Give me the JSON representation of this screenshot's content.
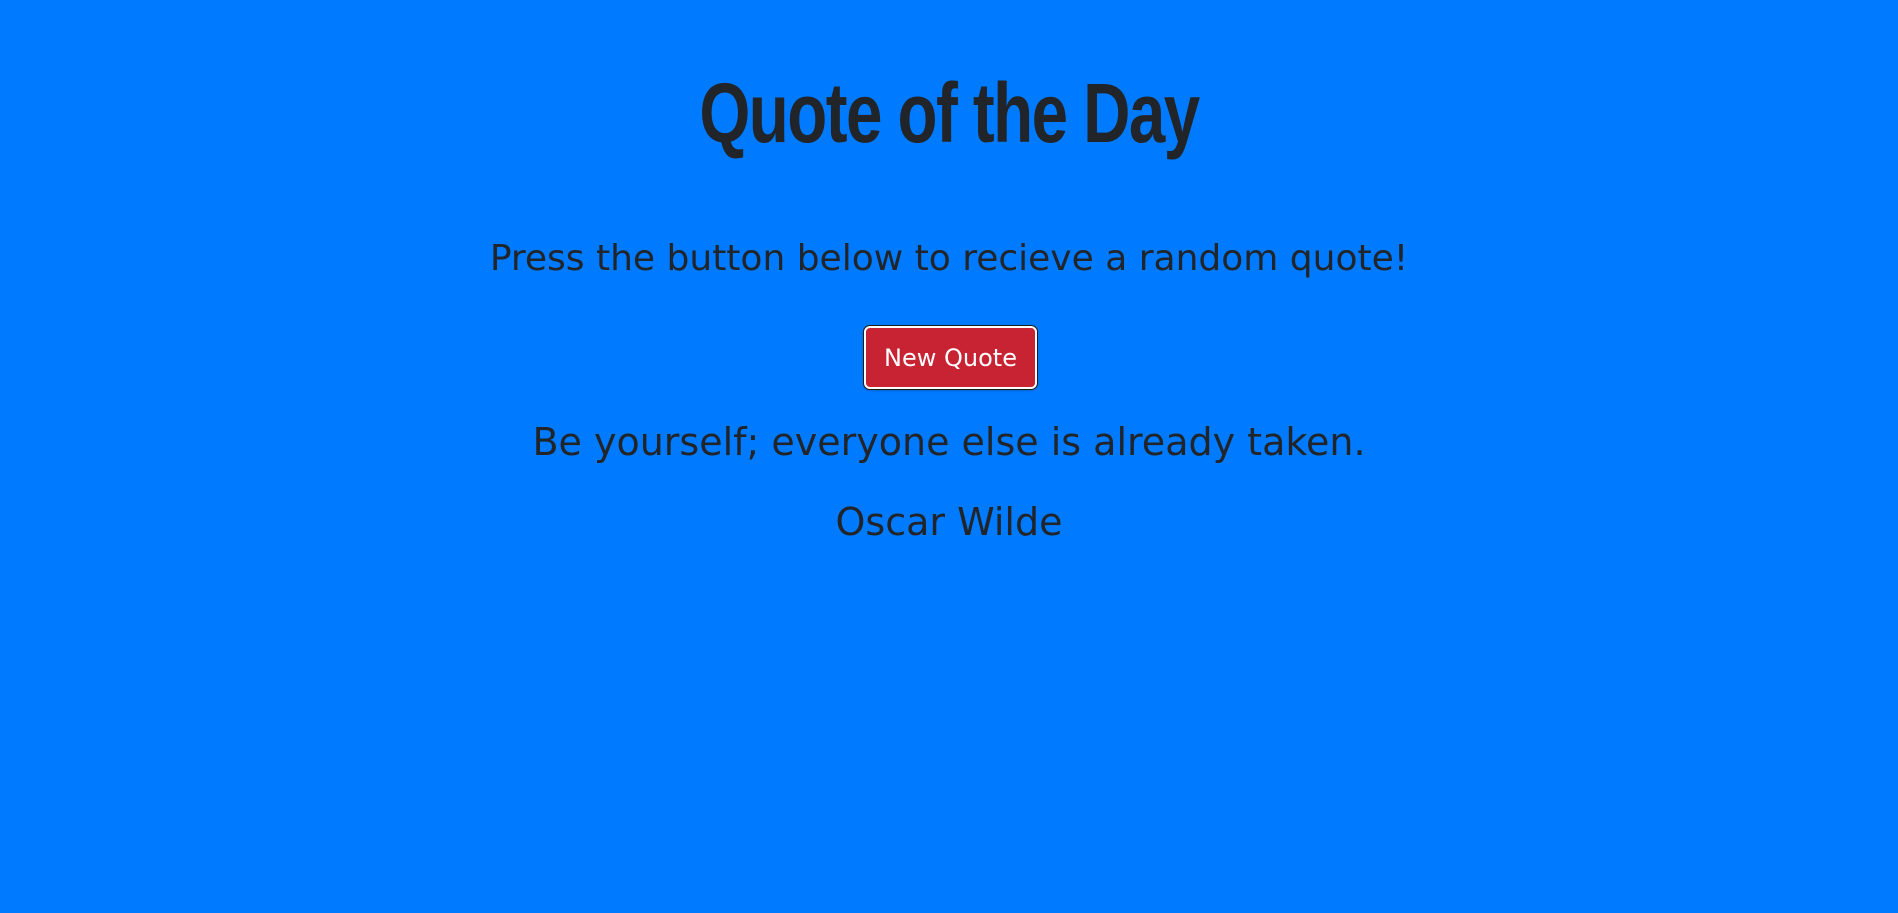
{
  "page": {
    "title": "Quote of the Day",
    "instruction": "Press the button below to recieve a random quote!",
    "button_label": "New Quote"
  },
  "quote": {
    "text": "Be yourself; everyone else is already taken.",
    "author": "Oscar Wilde"
  },
  "colors": {
    "background": "#007bff",
    "text": "#212529",
    "button_background": "#c82333",
    "button_text": "#ffffff"
  }
}
